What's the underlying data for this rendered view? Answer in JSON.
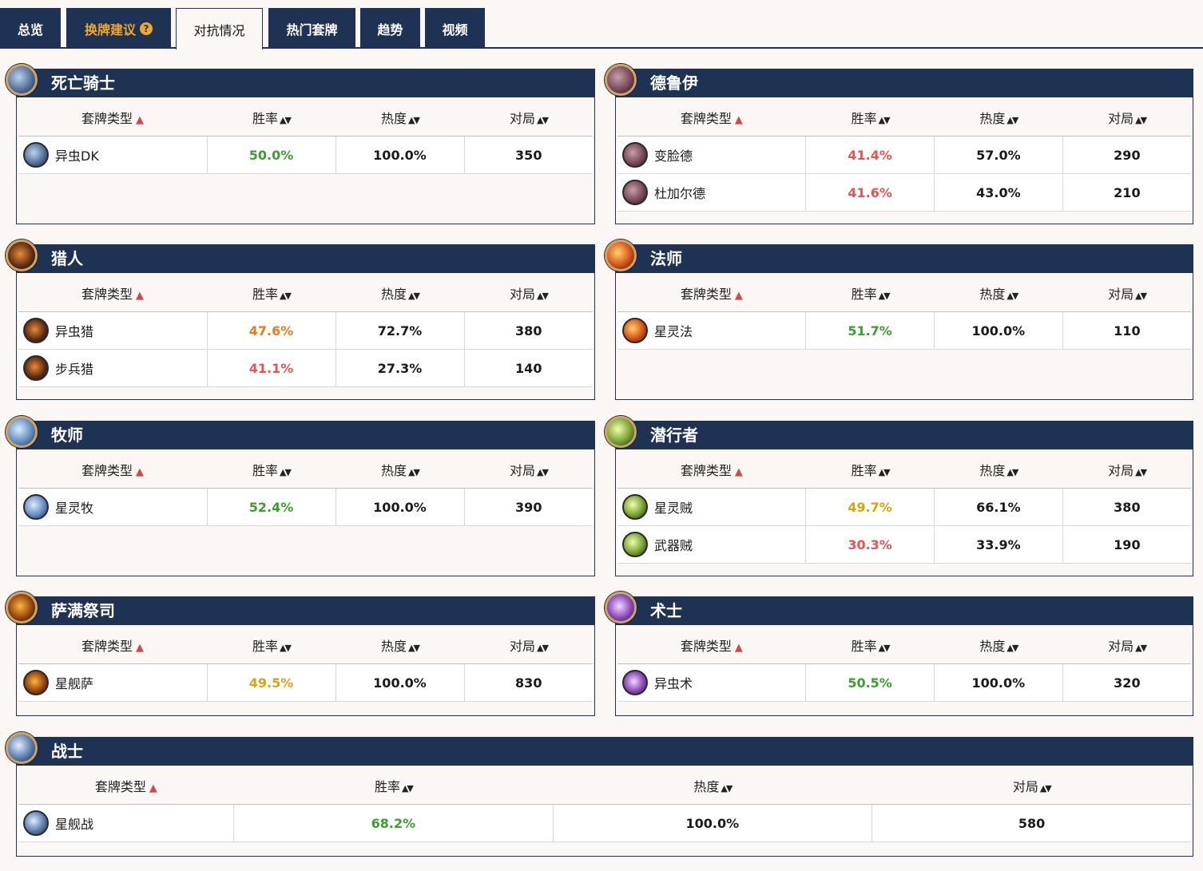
{
  "tabs": [
    {
      "label": "总览"
    },
    {
      "label": "换牌建议"
    },
    {
      "label": "对抗情况"
    },
    {
      "label": "热门套牌"
    },
    {
      "label": "趋势"
    },
    {
      "label": "视频"
    }
  ],
  "help_glyph": "?",
  "columns": {
    "deck_type": "套牌类型",
    "winrate": "胜率",
    "popularity": "热度",
    "games": "对局"
  },
  "sort_asc_glyph": "▲",
  "sort_glyph": "▲▼",
  "panels": [
    {
      "title": "死亡骑士",
      "icon": "death-knight-icon",
      "decks": [
        {
          "name": "异虫DK",
          "winrate": "50.0%",
          "popularity": "100.0%",
          "games": "350"
        }
      ]
    },
    {
      "title": "德鲁伊",
      "icon": "druid-icon",
      "decks": [
        {
          "name": "变脸德",
          "winrate": "41.4%",
          "popularity": "57.0%",
          "games": "290"
        },
        {
          "name": "杜加尔德",
          "winrate": "41.6%",
          "popularity": "43.0%",
          "games": "210"
        }
      ]
    },
    {
      "title": "猎人",
      "icon": "hunter-icon",
      "decks": [
        {
          "name": "异虫猎",
          "winrate": "47.6%",
          "popularity": "72.7%",
          "games": "380"
        },
        {
          "name": "步兵猎",
          "winrate": "41.1%",
          "popularity": "27.3%",
          "games": "140"
        }
      ]
    },
    {
      "title": "法师",
      "icon": "mage-icon",
      "decks": [
        {
          "name": "星灵法",
          "winrate": "51.7%",
          "popularity": "100.0%",
          "games": "110"
        }
      ]
    },
    {
      "title": "牧师",
      "icon": "priest-icon",
      "decks": [
        {
          "name": "星灵牧",
          "winrate": "52.4%",
          "popularity": "100.0%",
          "games": "390"
        }
      ]
    },
    {
      "title": "潜行者",
      "icon": "rogue-icon",
      "decks": [
        {
          "name": "星灵贼",
          "winrate": "49.7%",
          "popularity": "66.1%",
          "games": "380"
        },
        {
          "name": "武器贼",
          "winrate": "30.3%",
          "popularity": "33.9%",
          "games": "190"
        }
      ]
    },
    {
      "title": "萨满祭司",
      "icon": "shaman-icon",
      "decks": [
        {
          "name": "星舰萨",
          "winrate": "49.5%",
          "popularity": "100.0%",
          "games": "830"
        }
      ]
    },
    {
      "title": "术士",
      "icon": "warlock-icon",
      "decks": [
        {
          "name": "异虫术",
          "winrate": "50.5%",
          "popularity": "100.0%",
          "games": "320"
        }
      ]
    },
    {
      "title": "战士",
      "icon": "warrior-icon",
      "decks": [
        {
          "name": "星舰战",
          "winrate": "68.2%",
          "popularity": "100.0%",
          "games": "580"
        }
      ]
    }
  ],
  "colors": {
    "header_navy": "#1e3254",
    "tab_highlight": "#f3a72a",
    "winrate_green": "#39a02c",
    "winrate_red": "#ef5050",
    "winrate_orange": "#f07a1a",
    "winrate_yellow": "#d3a600"
  }
}
